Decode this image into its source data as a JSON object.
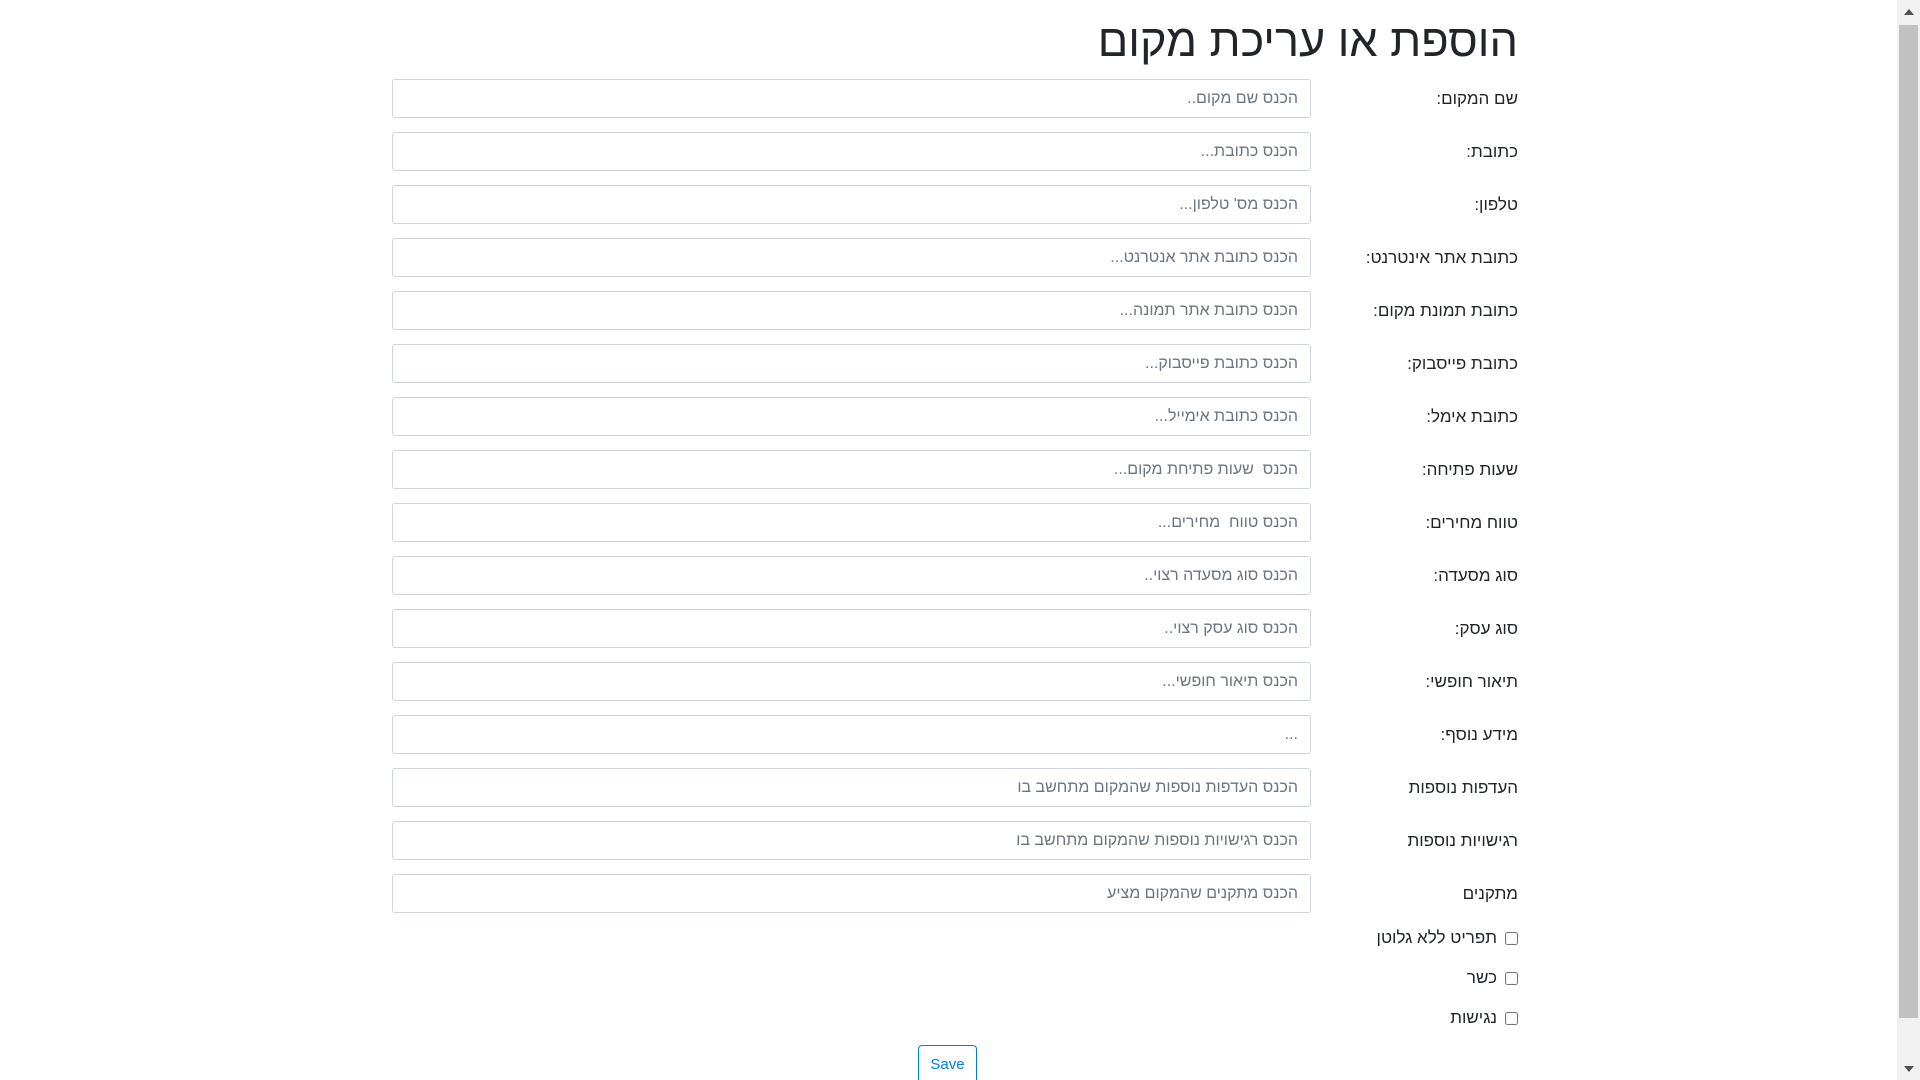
{
  "page": {
    "title": "הוספת או עריכת מקום"
  },
  "form": {
    "fields": [
      {
        "label": "שם המקום:",
        "placeholder": "הכנס שם מקום.."
      },
      {
        "label": "כתובת:",
        "placeholder": "הכנס כתובת..."
      },
      {
        "label": "טלפון:",
        "placeholder": "הכנס מס' טלפון..."
      },
      {
        "label": "כתובת אתר אינטרנט:",
        "placeholder": "הכנס כתובת אתר אנטרנט..."
      },
      {
        "label": "כתובת תמונת מקום:",
        "placeholder": "הכנס כתובת אתר תמונה..."
      },
      {
        "label": "כתובת פייסבוק:",
        "placeholder": "הכנס כתובת פייסבוק..."
      },
      {
        "label": "כתובת אימל:",
        "placeholder": "הכנס כתובת אימייל..."
      },
      {
        "label": "שעות פתיחה:",
        "placeholder": "הכנס  שעות פתיחת מקום..."
      },
      {
        "label": "טווח מחירים:",
        "placeholder": "הכנס טווח  מחירים..."
      },
      {
        "label": "סוג מסעדה:",
        "placeholder": "הכנס סוג מסעדה רצוי.."
      },
      {
        "label": "סוג עסק:",
        "placeholder": "הכנס סוג עסק רצוי.."
      },
      {
        "label": "תיאור חופשי:",
        "placeholder": "הכנס תיאור חופשי..."
      },
      {
        "label": "מידע נוסף:",
        "placeholder": "..."
      },
      {
        "label": "העדפות נוספות",
        "placeholder": "הכנס העדפות נוספות שהמקום מתחשב בו"
      },
      {
        "label": "רגישויות נוספות",
        "placeholder": "הכנס רגישויות נוספות שהמקום מתחשב בו"
      },
      {
        "label": "מתקנים",
        "placeholder": "הכנס מתקנים שהמקום מציע"
      }
    ],
    "checkboxes": [
      {
        "label": "תפריט ללא גלוטן",
        "checked": false
      },
      {
        "label": "כשר",
        "checked": false
      },
      {
        "label": "נגישות",
        "checked": false
      }
    ],
    "save_label": "Save"
  },
  "colors": {
    "primary": "#007bff",
    "border": "#ced4da",
    "placeholder": "#6c757d",
    "text": "#212529"
  },
  "icons": {
    "scroll_up": "triangle-up-icon",
    "scroll_down": "triangle-down-icon"
  }
}
